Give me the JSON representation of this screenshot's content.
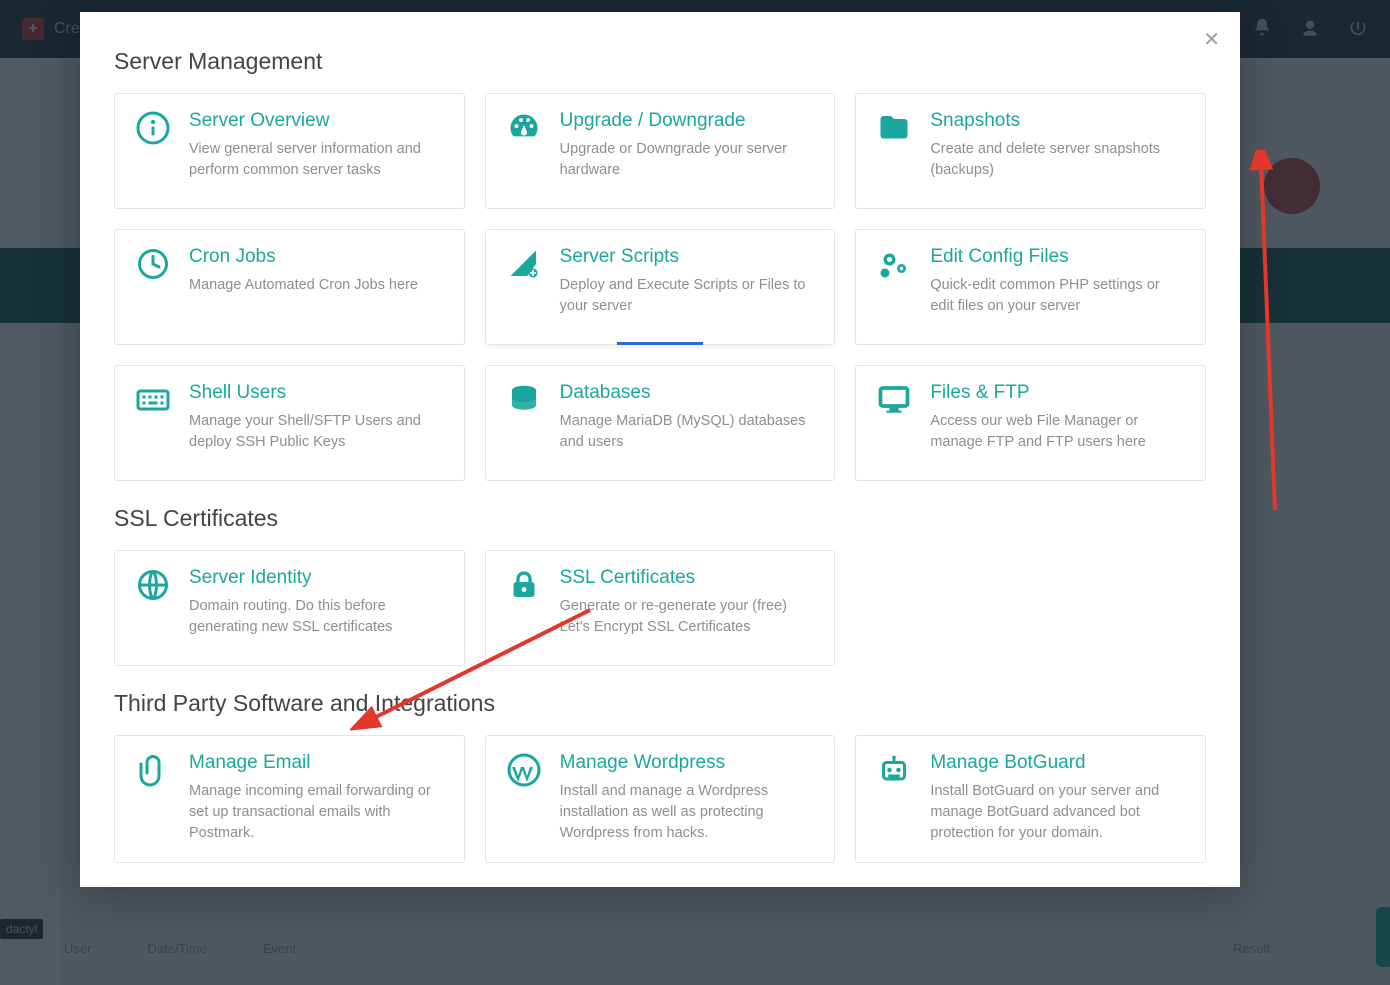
{
  "topbar": {
    "create": "Create"
  },
  "taskbar_chip": "dactyl",
  "footer": {
    "col1": "User",
    "col2": "Date/Time",
    "col3": "Event",
    "col4": "Result"
  },
  "modal": {
    "sections": {
      "server_management": "Server Management",
      "ssl": "SSL Certificates",
      "third_party": "Third Party Software and Integrations"
    },
    "cards": {
      "server_overview": {
        "title": "Server Overview",
        "desc": "View general server information and perform common server tasks"
      },
      "upgrade": {
        "title": "Upgrade / Downgrade",
        "desc": "Upgrade or Downgrade your server hardware"
      },
      "snapshots": {
        "title": "Snapshots",
        "desc": "Create and delete server snapshots (backups)"
      },
      "cron": {
        "title": "Cron Jobs",
        "desc": "Manage Automated Cron Jobs here"
      },
      "scripts": {
        "title": "Server Scripts",
        "desc": "Deploy and Execute Scripts or Files to your server"
      },
      "config": {
        "title": "Edit Config Files",
        "desc": "Quick-edit common PHP settings or edit files on your server"
      },
      "shell": {
        "title": "Shell Users",
        "desc": "Manage your Shell/SFTP Users and deploy SSH Public Keys"
      },
      "databases": {
        "title": "Databases",
        "desc": "Manage MariaDB (MySQL) databases and users"
      },
      "files": {
        "title": "Files & FTP",
        "desc": "Access our web File Manager or manage FTP and FTP users here"
      },
      "identity": {
        "title": "Server Identity",
        "desc": "Domain routing. Do this before generating new SSL certificates"
      },
      "sslcert": {
        "title": "SSL Certificates",
        "desc": "Generate or re-generate your (free) Let's Encrypt SSL Certificates"
      },
      "email": {
        "title": "Manage Email",
        "desc": "Manage incoming email forwarding or set up transactional emails with Postmark."
      },
      "wordpress": {
        "title": "Manage Wordpress",
        "desc": "Install and manage a Wordpress installation as well as protecting Wordpress from hacks."
      },
      "botguard": {
        "title": "Manage BotGuard",
        "desc": "Install BotGuard on your server and manage BotGuard advanced bot protection for your domain."
      }
    }
  }
}
